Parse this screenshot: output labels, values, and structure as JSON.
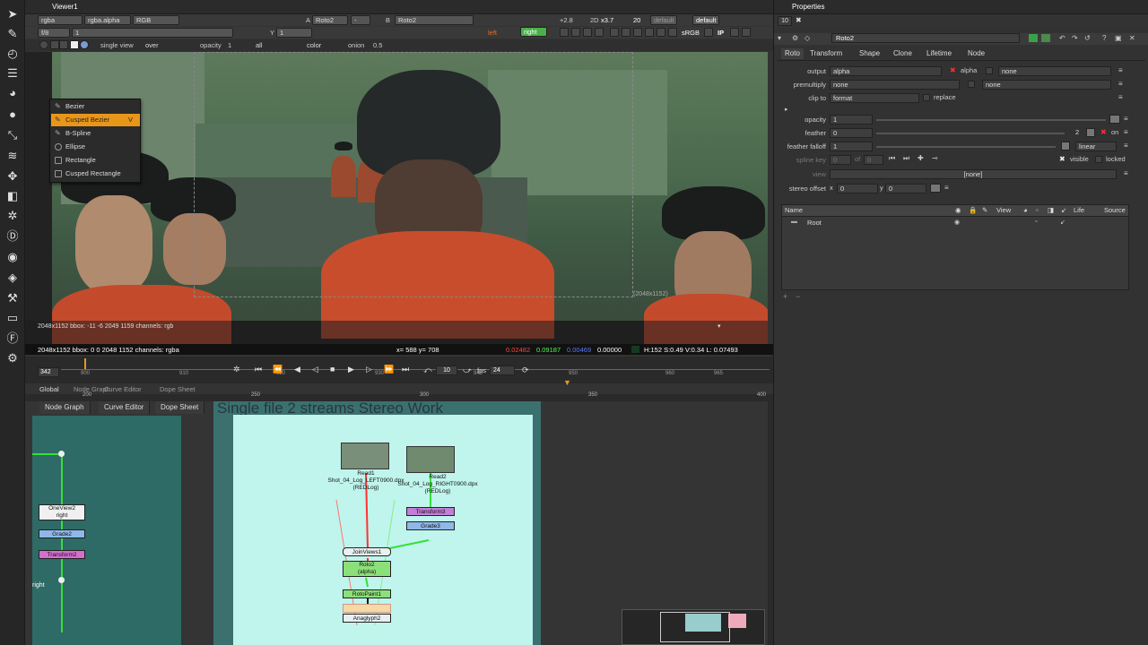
{
  "viewer": {
    "tab_title": "Viewer1",
    "row1": {
      "channels": "rgba",
      "layer": "rgba.alpha",
      "display": "RGB",
      "a_label": "A",
      "a_input": "Roto2",
      "dash1": "-",
      "b_label": "B",
      "b_input": "Roto2",
      "gain": "+2.8",
      "dim": "2D",
      "zoom": "x3.7",
      "proxy": "20",
      "default1": "default",
      "default2": "default"
    },
    "row2": {
      "frame_label": "f/8",
      "frame_value": "1",
      "y_label": "Y",
      "y_value": "1",
      "left_view": "left",
      "right_view": "right",
      "srgb": "sRGB"
    },
    "row3": {
      "view_mode": "single view",
      "wipe": "over",
      "opacity_label": "opacity",
      "opacity_value": "1",
      "all": "all",
      "color": "color",
      "onion_label": "onion",
      "onion_value": "0.5"
    },
    "canvas_format": "(2048x1152)",
    "canvas_bbox": "2048x1152  bbox: -11 -6 2049 1159  channels: rgb",
    "info": {
      "format": "2048x1152  bbox: 0 0 2048 1152  channels: rgba",
      "coords": "x= 588  y= 708",
      "r": "0.02482",
      "g": "0.09187",
      "b": "0.00469",
      "a": "0.00000",
      "hsvl": "H:152  S:0.49  V:0.34   L: 0.07493"
    },
    "timeline": {
      "ticks": [
        "900",
        "910",
        "920",
        "930",
        "940",
        "950",
        "960",
        "965"
      ],
      "current_frame": "342",
      "skip": "10",
      "fps_label": "fps",
      "fps": "24",
      "lower_ticks": [
        "200",
        "250",
        "300",
        "350",
        "400"
      ],
      "global": "Global"
    }
  },
  "context_menu": {
    "items": [
      {
        "label": "Bezier",
        "shortcut": ""
      },
      {
        "label": "Cusped Bezier",
        "shortcut": "V"
      },
      {
        "label": "B-Spline",
        "shortcut": ""
      },
      {
        "label": "Ellipse",
        "shortcut": ""
      },
      {
        "label": "Rectangle",
        "shortcut": ""
      },
      {
        "label": "Cusped Rectangle",
        "shortcut": ""
      }
    ]
  },
  "mid_tabs": [
    "Node Graph",
    "Curve Editor",
    "Dope Sheet"
  ],
  "node_graph": {
    "tabs": [
      "Node Graph",
      "Curve Editor",
      "Dope Sheet"
    ],
    "backdrop_title": "Single file  2 streams Stereo Work",
    "left_nodes": [
      "OneView2\nright",
      "Grade2",
      "Transform2"
    ],
    "right_label": "right",
    "nodes": {
      "read1": "Read1\nShot_04_Log_LEFT0900.dpx\n(REDLog)",
      "read2": "Read2\nShot_04_Log_RIGHT0900.dpx\n(REDLog)",
      "transform3": "Transform3",
      "grade3": "Grade3",
      "joinviews": "JoinViews1",
      "roto2": "Roto2\n(alpha)",
      "rotopaint": "RotoPaint1",
      "anaglyph": "Anaglyph2"
    }
  },
  "properties": {
    "title": "Properties",
    "count": "10",
    "node_name": "Roto2",
    "tabs": [
      "Roto",
      "Transform",
      "Shape",
      "Clone",
      "Lifetime",
      "Node"
    ],
    "output_label": "output",
    "output_value": "alpha",
    "output_channel": "alpha",
    "output_none": "none",
    "premultiply_label": "premultiply",
    "premultiply_value": "none",
    "premultiply_none": "none",
    "clipto_label": "clip to",
    "clipto_value": "format",
    "replace_label": "replace",
    "opacity_label": "opacity",
    "opacity_value": "1",
    "feather_label": "feather",
    "feather_value": "0",
    "feather_slider_value": "2",
    "feather_on": "on",
    "falloff_label": "feather falloff",
    "falloff_value": "1",
    "falloff_type": "linear",
    "splinekey_label": "spline key",
    "splinekey_value": "0",
    "splinekey_of": "of",
    "splinekey_total": "0",
    "visible_label": "visible",
    "locked_label": "locked",
    "view_label": "view",
    "view_value": "[none]",
    "stereo_label": "stereo offset",
    "stereo_x_label": "x",
    "stereo_x": "0",
    "stereo_y_label": "y",
    "stereo_y": "0",
    "tree_columns": [
      "Name",
      "View",
      "Life",
      "Source"
    ],
    "tree_root": "Root"
  },
  "colors": {
    "accent": "#e8961a",
    "backdrop": "#bff5ec",
    "node_read": "#8f8f8f",
    "node_grade": "#8fb8e8",
    "node_transform": "#b878d6",
    "node_roto": "#8ce07a"
  }
}
